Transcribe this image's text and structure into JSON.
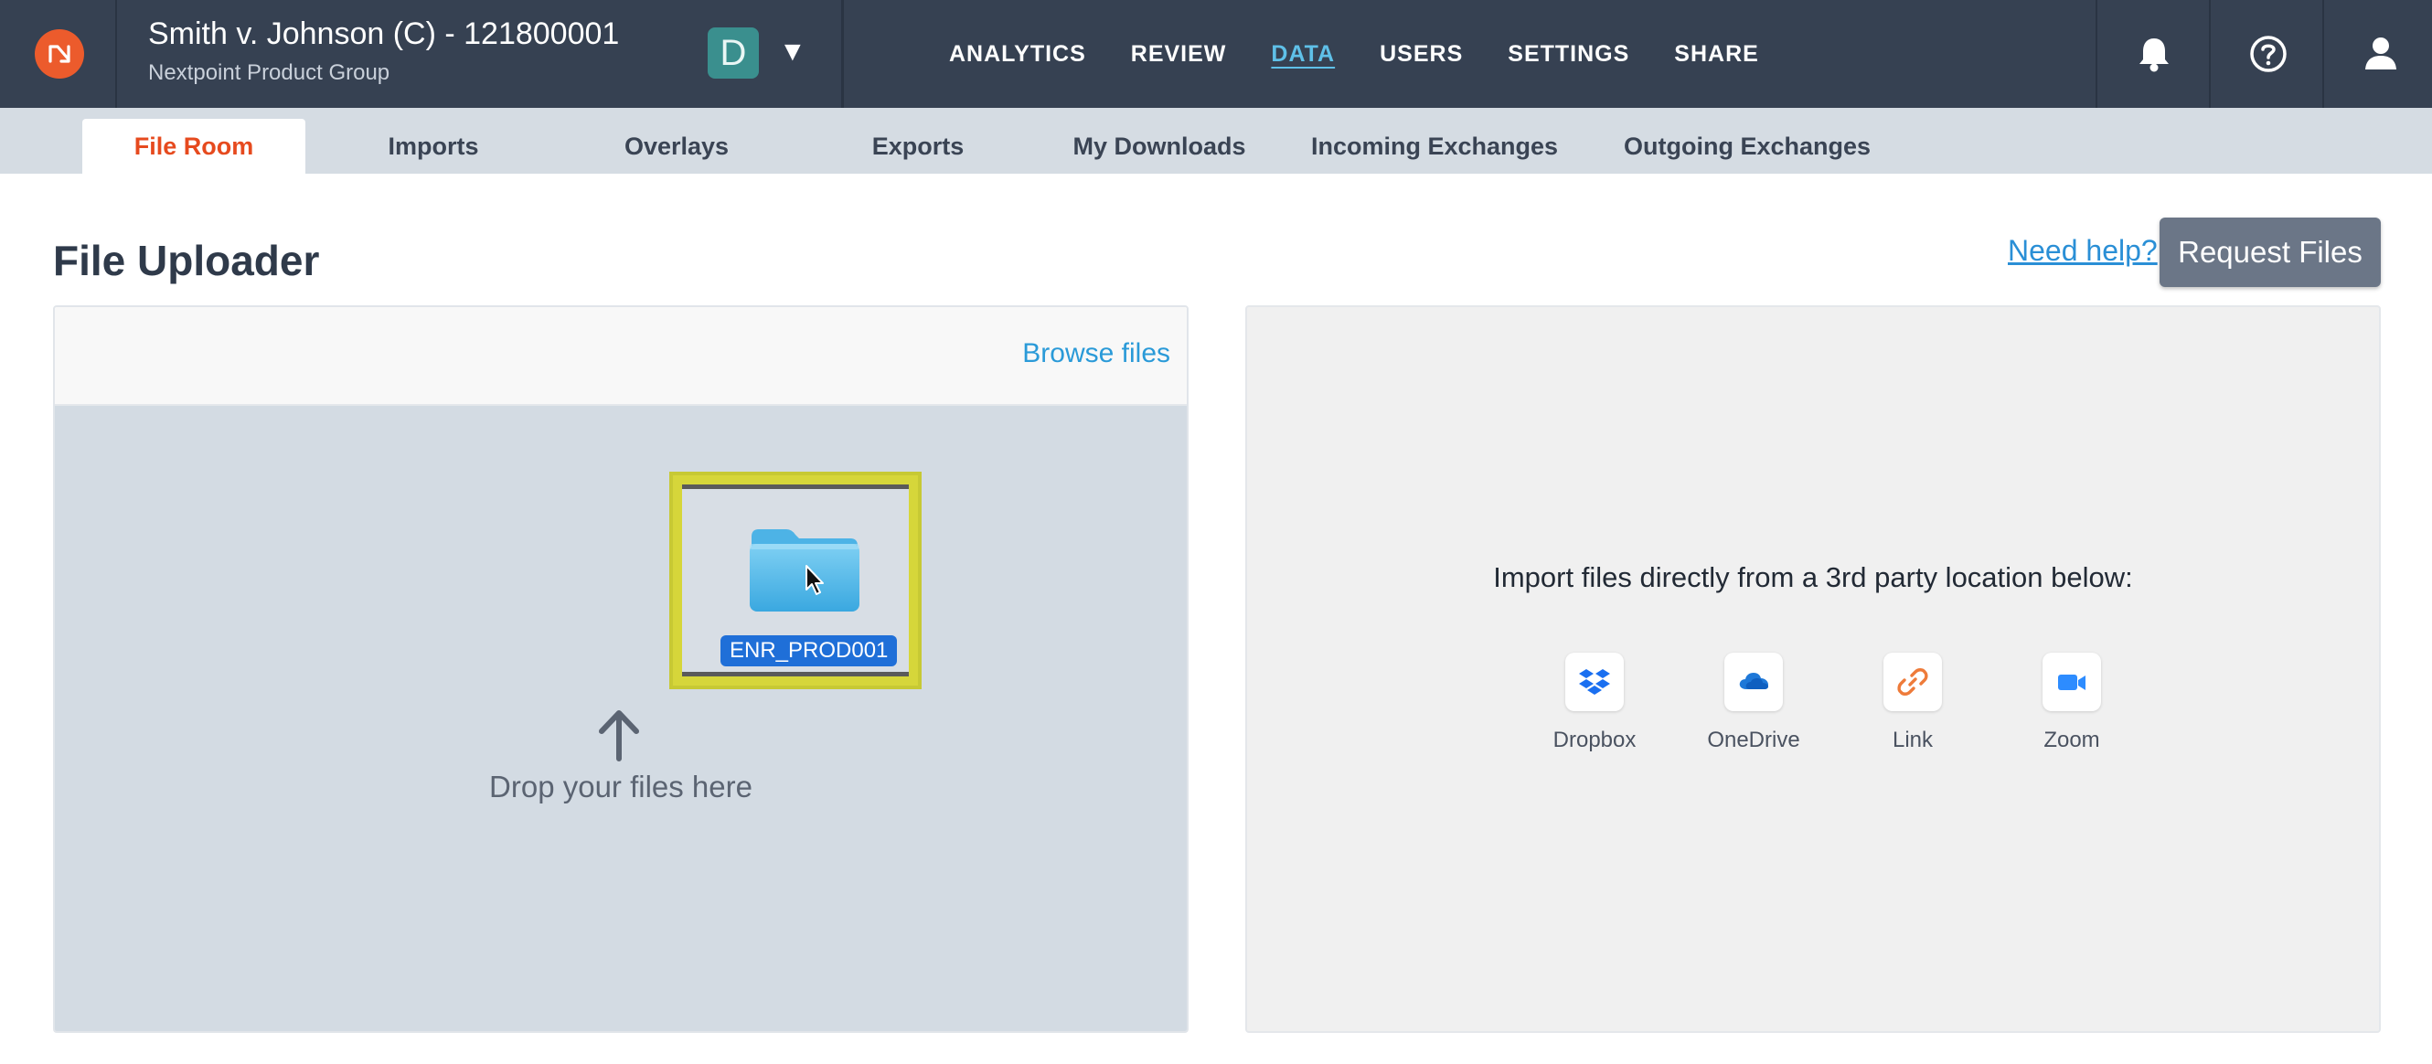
{
  "header": {
    "case_title": "Smith v. Johnson (C) - 121800001",
    "case_subtitle": "Nextpoint Product Group",
    "db_badge": "D",
    "db_caret": "▼",
    "nav": [
      "ANALYTICS",
      "REVIEW",
      "DATA",
      "USERS",
      "SETTINGS",
      "SHARE"
    ],
    "active_nav": "DATA",
    "icons": [
      "bell-icon",
      "help-icon",
      "user-icon"
    ]
  },
  "subtabs": {
    "items": [
      "File Room",
      "Imports",
      "Overlays",
      "Exports",
      "My Downloads",
      "Incoming Exchanges",
      "Outgoing Exchanges"
    ],
    "active": "File Room"
  },
  "page": {
    "title": "File Uploader",
    "need_help": "Need help?",
    "request_files": "Request Files"
  },
  "uploader": {
    "browse": "Browse files",
    "drag_item": "ENR_PROD001",
    "drop_text": "Drop your files here"
  },
  "third_party": {
    "text": "Import files directly from a 3rd party location below:",
    "providers": [
      "Dropbox",
      "OneDrive",
      "Link",
      "Zoom"
    ]
  },
  "colors": {
    "topbar": "#364152",
    "accent_orange": "#e64a1e",
    "link_blue": "#2a9ad8",
    "drag_highlight": "#d6d63a"
  }
}
